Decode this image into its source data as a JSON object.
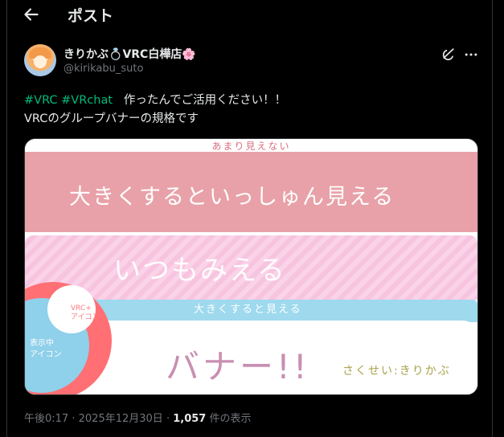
{
  "header": {
    "title": "ポスト"
  },
  "author": {
    "name": "きりかぶ",
    "name_ring": "💍",
    "name_suffix": "VRC白樺店",
    "name_flower": "🌸",
    "handle": "@kirikabu_suto"
  },
  "tweet": {
    "hashtag1": "#VRC",
    "hashtag2": "#VRchat",
    "line1_rest": "作ったんでご活用ください！！",
    "line2": "VRCのグループバナーの規格です"
  },
  "image": {
    "text_amari": "あまり見えない",
    "text_ookiku": "大きくするといっしゅん見える",
    "text_itsumo": "いつもみえる",
    "text_ookikuru": "大きくすると見える",
    "text_banner": "バナー!!",
    "text_sakusei": "さくせい:きりかぶ",
    "text_vrc_icon": "VRC+\nアイコン",
    "text_hyoji": "表示中\nアイコン"
  },
  "meta": {
    "time": "午後0:17",
    "sep1": "·",
    "date": "2025年12月30日",
    "sep2": "·",
    "views": "1,057",
    "views_label": "件の表示"
  }
}
